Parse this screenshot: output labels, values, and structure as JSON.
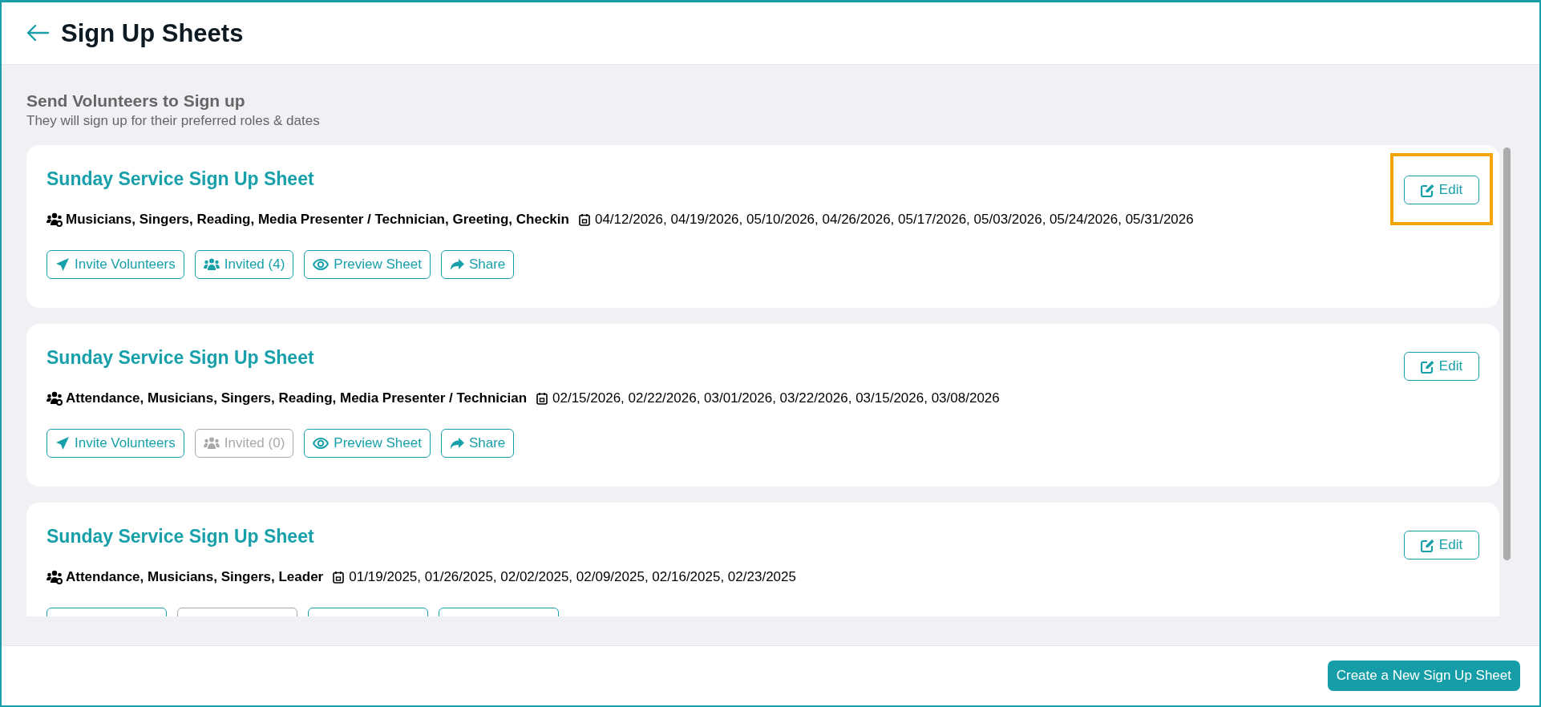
{
  "header": {
    "title": "Sign Up Sheets"
  },
  "intro": {
    "heading": "Send Volunteers to Sign up",
    "subtitle": "They will sign up for their preferred roles & dates"
  },
  "sheets": [
    {
      "title": "Sunday Service Sign Up Sheet",
      "roles": "Musicians, Singers, Reading, Media Presenter / Technician, Greeting, Checkin",
      "dates": "04/12/2026, 04/19/2026, 05/10/2026, 04/26/2026, 05/17/2026, 05/03/2026, 05/24/2026, 05/31/2026",
      "edit": {
        "label": "Edit",
        "highlighted": true
      },
      "actions": [
        {
          "kind": "invite",
          "label": "Invite Volunteers",
          "disabled": false
        },
        {
          "kind": "invited",
          "label": "Invited (4)",
          "disabled": false
        },
        {
          "kind": "preview",
          "label": "Preview Sheet",
          "disabled": false
        },
        {
          "kind": "share",
          "label": "Share",
          "disabled": false
        }
      ]
    },
    {
      "title": "Sunday Service Sign Up Sheet",
      "roles": "Attendance, Musicians, Singers, Reading, Media Presenter / Technician",
      "dates": "02/15/2026, 02/22/2026, 03/01/2026, 03/22/2026, 03/15/2026, 03/08/2026",
      "edit": {
        "label": "Edit",
        "highlighted": false
      },
      "actions": [
        {
          "kind": "invite",
          "label": "Invite Volunteers",
          "disabled": false
        },
        {
          "kind": "invited",
          "label": "Invited (0)",
          "disabled": true
        },
        {
          "kind": "preview",
          "label": "Preview Sheet",
          "disabled": false
        },
        {
          "kind": "share",
          "label": "Share",
          "disabled": false
        }
      ]
    },
    {
      "title": "Sunday Service Sign Up Sheet",
      "roles": "Attendance, Musicians, Singers, Leader",
      "dates": "01/19/2025, 01/26/2025, 02/02/2025, 02/09/2025, 02/16/2025, 02/23/2025",
      "edit": {
        "label": "Edit",
        "highlighted": false
      },
      "actions": [
        {
          "kind": "invite",
          "disabled": false
        },
        {
          "kind": "invited",
          "disabled": true
        },
        {
          "kind": "preview",
          "disabled": false
        },
        {
          "kind": "share",
          "disabled": false
        }
      ]
    }
  ],
  "footer": {
    "create_button": "Create a New Sign Up Sheet"
  }
}
